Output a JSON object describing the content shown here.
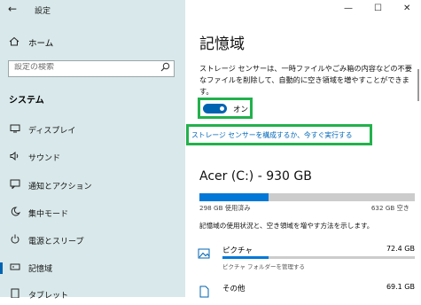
{
  "window": {
    "title": "設定",
    "back_icon": "back-arrow-icon",
    "minimize_icon": "minimize-icon",
    "maximize_icon": "maximize-icon",
    "close_icon": "close-icon"
  },
  "sidebar": {
    "home_label": "ホーム",
    "search_placeholder": "設定の検索",
    "section_title": "システム",
    "items": [
      {
        "label": "ディスプレイ",
        "icon": "display-icon",
        "active": false
      },
      {
        "label": "サウンド",
        "icon": "speaker-icon",
        "active": false
      },
      {
        "label": "通知とアクション",
        "icon": "notification-icon",
        "active": false
      },
      {
        "label": "集中モード",
        "icon": "moon-icon",
        "active": false
      },
      {
        "label": "電源とスリープ",
        "icon": "power-icon",
        "active": false
      },
      {
        "label": "記憶域",
        "icon": "storage-icon",
        "active": true
      },
      {
        "label": "タブレット",
        "icon": "tablet-icon",
        "active": false
      }
    ]
  },
  "main": {
    "title": "記憶域",
    "description": "ストレージ センサーは、一時ファイルやごみ箱の内容などの不要なファイルを削除して、自動的に空き領域を増やすことができます。",
    "toggle": {
      "state_label": "オン",
      "on": true
    },
    "configure_link": "ストレージ センサーを構成するか、今すぐ実行する",
    "drive": {
      "title": "Acer (C:) - 930 GB",
      "used_label": "298 GB 使用済み",
      "free_label": "632 GB 空き",
      "used_fraction": 0.32
    },
    "hint": "記憶域の使用状況と、空き領域を増やす方法を示します。",
    "categories": [
      {
        "name": "ピクチャ",
        "size": "72.4 GB",
        "subtitle": "ピクチャ フォルダーを管理する",
        "fraction": 0.24,
        "icon": "picture-icon"
      },
      {
        "name": "その他",
        "size": "69.1 GB",
        "subtitle": "",
        "fraction": 0.23,
        "icon": "other-file-icon"
      }
    ]
  },
  "colors": {
    "accent": "#0063b1",
    "highlight": "#22b14c",
    "link": "#0067b8",
    "sidebar_bg": "#d9e8ea"
  }
}
